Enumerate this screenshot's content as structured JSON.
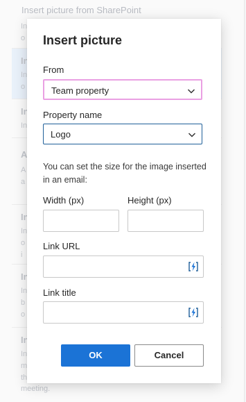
{
  "background": {
    "header": "Insert picture from SharePoint",
    "rows": [
      {
        "title": "In",
        "lines": [
          "In",
          "o"
        ]
      },
      {
        "title": "In",
        "lines": [
          "In",
          "o"
        ]
      },
      {
        "title": "In",
        "lines": [
          "In"
        ]
      },
      {
        "title": "A",
        "lines": [
          "A",
          "a"
        ]
      },
      {
        "title": "In",
        "lines": [
          "In",
          "o",
          "i"
        ]
      },
      {
        "title": "In",
        "lines": [
          "In",
          "b",
          "o"
        ]
      },
      {
        "title": "In",
        "lines": [
          "In",
          "m",
          "th",
          ""
        ]
      }
    ],
    "footer_text": "meeting."
  },
  "dialog": {
    "title": "Insert picture",
    "from": {
      "label": "From",
      "value": "Team property",
      "chevron": "chevron-down-icon"
    },
    "property": {
      "label": "Property name",
      "value": "Logo",
      "chevron": "chevron-down-icon"
    },
    "help_text": "You can set the size for the image inserted in an email:",
    "width": {
      "label": "Width (px)",
      "value": ""
    },
    "height": {
      "label": "Height (px)",
      "value": ""
    },
    "link_url": {
      "label": "Link URL",
      "value": "",
      "icon": "dynamic-content-icon"
    },
    "link_title": {
      "label": "Link title",
      "value": "",
      "icon": "dynamic-content-icon"
    },
    "ok_label": "OK",
    "cancel_label": "Cancel"
  },
  "colors": {
    "accent": "#1b73d6",
    "focus_outline": "#eaa0e3",
    "select_border": "#1f5f99"
  }
}
